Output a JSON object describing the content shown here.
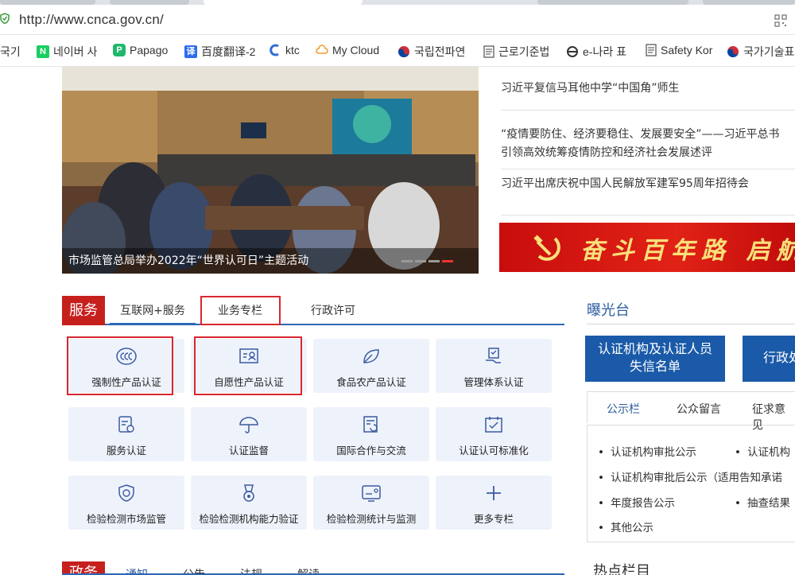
{
  "browser": {
    "url": "http://www.cnca.gov.cn/",
    "bookmarks": [
      {
        "label": "국기",
        "icon": "folder-icon",
        "color": "#ffffff"
      },
      {
        "label": "네이버 사",
        "icon": "naver-icon",
        "color": "#19ce60"
      },
      {
        "label": "Papago",
        "icon": "papago-icon",
        "color": "#1fb86b"
      },
      {
        "label": "百度翻译-2",
        "icon": "baidu-translate-icon",
        "color": "#2b6cf0"
      },
      {
        "label": "ktc",
        "icon": "ktc-icon",
        "color": "#2f6fd6"
      },
      {
        "label": "My Cloud",
        "icon": "cloud-icon",
        "color": "#f39c2a"
      },
      {
        "label": "국립전파연",
        "icon": "korea-emblem-icon",
        "color": "#cd2e3a"
      },
      {
        "label": "근로기준법",
        "icon": "document-icon",
        "color": "#666666"
      },
      {
        "label": "e-나라 표",
        "icon": "e-nara-icon",
        "color": "#333333"
      },
      {
        "label": "Safety Kor",
        "icon": "document-icon",
        "color": "#666666"
      },
      {
        "label": "국가기술표",
        "icon": "korea-emblem-icon",
        "color": "#cd2e3a"
      }
    ]
  },
  "hero": {
    "caption": "市场监管总局举办2022年“世界认可日”主题活动"
  },
  "news": [
    "习近平复信马耳他中学“中国角”师生",
    "“疫情要防住、经济要稳住、发展要安全”——习近平总书",
    "引领高效统筹疫情防控和经济社会发展述评",
    "习近平出席庆祝中国人民解放军建军95周年招待会"
  ],
  "banner": {
    "text": "奋斗百年路 启航新"
  },
  "services": {
    "title": "服务",
    "tabs": [
      "互联网+服务",
      "业务专栏",
      "行政许可"
    ],
    "tiles": [
      {
        "label": "强制性产品认证",
        "icon": "ccc-mark-icon"
      },
      {
        "label": "自愿性产品认证",
        "icon": "certificate-icon"
      },
      {
        "label": "食品农产品认证",
        "icon": "leaf-icon"
      },
      {
        "label": "管理体系认证",
        "icon": "hand-certificate-icon"
      },
      {
        "label": "服务认证",
        "icon": "service-document-icon"
      },
      {
        "label": "认证监督",
        "icon": "umbrella-icon"
      },
      {
        "label": "国际合作与交流",
        "icon": "exchange-document-icon"
      },
      {
        "label": "认证认可标准化",
        "icon": "calendar-check-icon"
      },
      {
        "label": "检验检测市场监管",
        "icon": "shield-check-icon"
      },
      {
        "label": "检验检测机构能力验证",
        "icon": "medal-icon"
      },
      {
        "label": "检验检测统计与监测",
        "icon": "monitor-icon"
      },
      {
        "label": "更多专栏",
        "icon": "plus-icon"
      }
    ]
  },
  "exposure": {
    "title": "曝光台",
    "card1": "认证机构及认证人员失信名单",
    "card1_line1": "认证机构及认证人员",
    "card1_line2": "失信名单",
    "card2": "行政处"
  },
  "publicity": {
    "tabs": [
      "公示栏",
      "公众留言",
      "征求意见"
    ],
    "items": [
      "认证机构审批公示",
      "认证机构",
      "认证机构审批后公示（适用告知承诺",
      "年度报告公示",
      "抽查结果",
      "其他公示"
    ]
  },
  "hot": {
    "title": "热点栏目"
  },
  "gov": {
    "title": "政务",
    "tabs": [
      "通知",
      "公告",
      "法规",
      "解读"
    ]
  }
}
